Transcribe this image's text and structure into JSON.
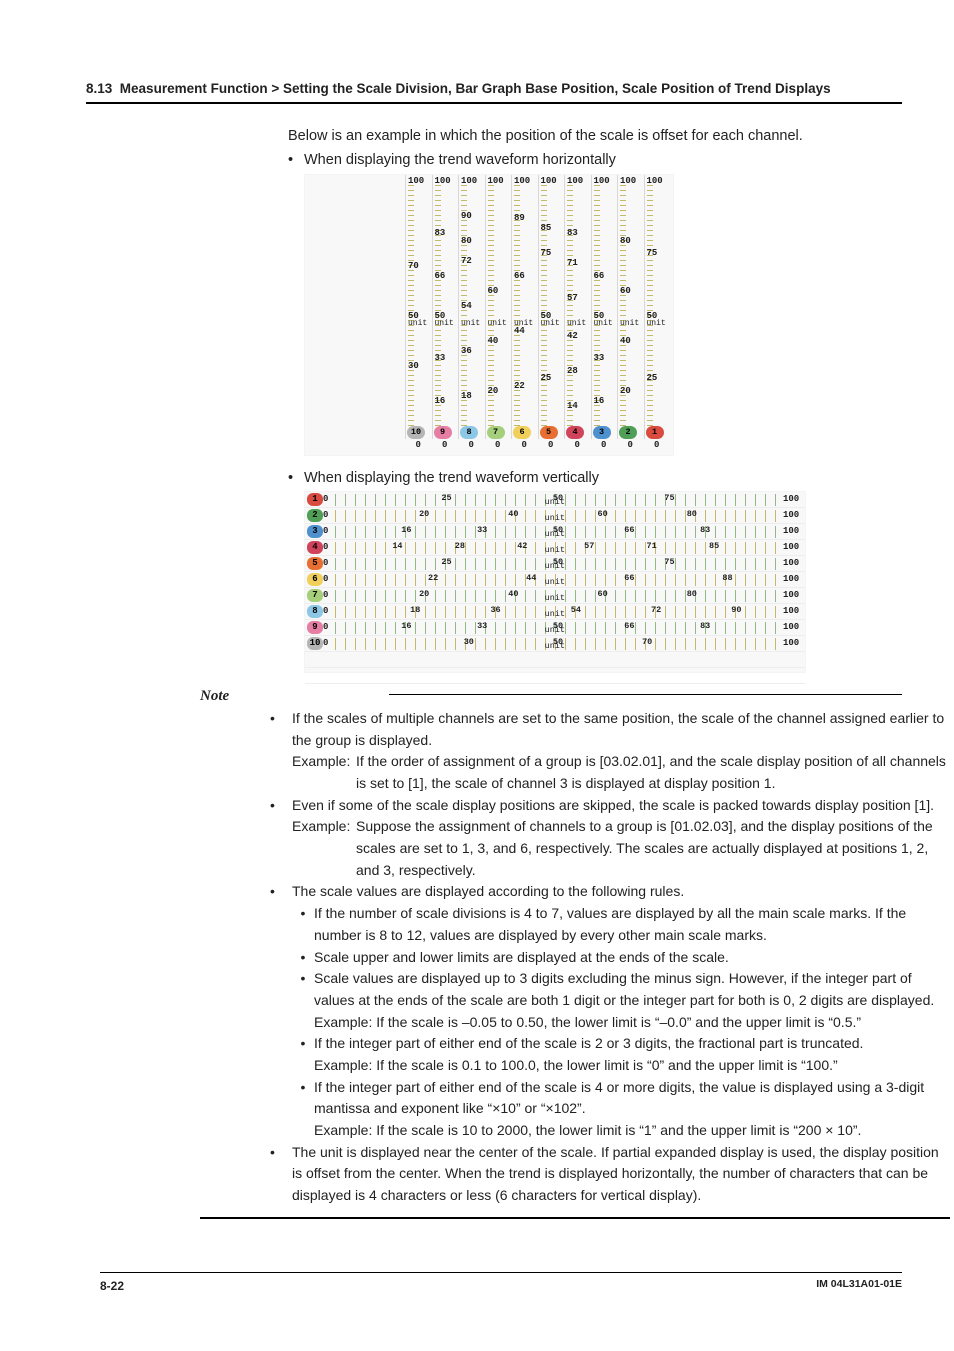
{
  "section_number": "8.13",
  "section_title": "Measurement Function > Setting the Scale Division, Bar Graph Base Position, Scale Position of Trend Displays",
  "lead": "Below is an example in which the position of the scale is offset for each channel.",
  "bullet_h": "When displaying the trend waveform horizontally",
  "bullet_v": "When displaying the trend waveform vertically",
  "fig_h": {
    "top_labels": [
      "100",
      "100",
      "100",
      "100",
      "100",
      "100",
      "100",
      "100",
      "100",
      "100"
    ],
    "zero_labels": [
      "0",
      "0",
      "0",
      "0",
      "0",
      "0",
      "0",
      "0",
      "0",
      "0"
    ],
    "unit_text": "unit",
    "cols": [
      {
        "tag": "10",
        "color": "#b5b5b5",
        "mids": [
          "70",
          "50",
          "30"
        ]
      },
      {
        "tag": "9",
        "color": "#e67ea3",
        "mids": [
          "83",
          "66",
          "50",
          "33",
          "16"
        ]
      },
      {
        "tag": "8",
        "color": "#8cc7e6",
        "mids": [
          "90",
          "80",
          "72",
          "54",
          "36",
          "18"
        ]
      },
      {
        "tag": "7",
        "color": "#a5cf7a",
        "mids": [
          "60",
          "40",
          "20"
        ]
      },
      {
        "tag": "6",
        "color": "#f0cf5b",
        "mids": [
          "89",
          "66",
          "44",
          "22"
        ]
      },
      {
        "tag": "5",
        "color": "#e86f34",
        "mids": [
          "85",
          "75",
          "50",
          "25"
        ]
      },
      {
        "tag": "4",
        "color": "#d1435b",
        "mids": [
          "83",
          "71",
          "57",
          "42",
          "28",
          "14"
        ]
      },
      {
        "tag": "3",
        "color": "#4f91cf",
        "mids": [
          "66",
          "50",
          "33",
          "16"
        ]
      },
      {
        "tag": "2",
        "color": "#4fa056",
        "mids": [
          "80",
          "60",
          "40",
          "20"
        ]
      },
      {
        "tag": "1",
        "color": "#d94a3f",
        "mids": [
          "75",
          "50",
          "25"
        ]
      }
    ]
  },
  "fig_v": {
    "rows": [
      {
        "tag": "1",
        "color": "#d94a3f",
        "ticks": [
          "0",
          "25",
          "50",
          "75",
          "100"
        ],
        "unit": "unit"
      },
      {
        "tag": "2",
        "color": "#4fa056",
        "ticks": [
          "0",
          "20",
          "40",
          "60",
          "80",
          "100"
        ],
        "unit": "unit"
      },
      {
        "tag": "3",
        "color": "#4f91cf",
        "ticks": [
          "0",
          "16",
          "33",
          "50",
          "66",
          "83",
          "100"
        ],
        "unit": "unit"
      },
      {
        "tag": "4",
        "color": "#d1435b",
        "ticks": [
          "0",
          "14",
          "28",
          "42",
          "57",
          "71",
          "85",
          "100"
        ],
        "unit": "unit"
      },
      {
        "tag": "5",
        "color": "#e86f34",
        "ticks": [
          "0",
          "25",
          "50",
          "75",
          "100"
        ],
        "unit": "unit"
      },
      {
        "tag": "6",
        "color": "#f0cf5b",
        "ticks": [
          "0",
          "22",
          "44",
          "66",
          "88",
          "100"
        ],
        "unit": "unit"
      },
      {
        "tag": "7",
        "color": "#a5cf7a",
        "ticks": [
          "0",
          "20",
          "40",
          "60",
          "80",
          "100"
        ],
        "unit": "unit"
      },
      {
        "tag": "8",
        "color": "#8cc7e6",
        "ticks": [
          "0",
          "18",
          "36",
          "54",
          "72",
          "90",
          "100"
        ],
        "unit": "unit"
      },
      {
        "tag": "9",
        "color": "#e67ea3",
        "ticks": [
          "0",
          "16",
          "33",
          "50",
          "66",
          "83",
          "100"
        ],
        "unit": "unit"
      },
      {
        "tag": "10",
        "color": "#b5b5b5",
        "ticks": [
          "0",
          "30",
          "50",
          "70",
          "100"
        ],
        "unit": "unit"
      }
    ]
  },
  "note_header": "Note",
  "notes": {
    "n1": "If the scales of multiple channels are set to the same position, the scale of the channel assigned earlier to the group is displayed.",
    "n1_ex_lbl": "Example:",
    "n1_ex": "If the order of assignment of a group is [03.02.01], and the scale display position of all channels is set to [1], the scale of channel 3 is displayed at display position 1.",
    "n2": "Even if some of the scale display positions are skipped, the scale is packed towards display position [1].",
    "n2_ex_lbl": "Example:",
    "n2_ex": "Suppose the assignment of channels to a group is [01.02.03], and the display positions of the scales are set to 1, 3, and 6, respectively.  The scales are actually displayed at positions 1, 2, and 3, respectively.",
    "n3": "The scale values are displayed according to the following rules.",
    "n3a": "If the number of scale divisions is 4 to 7, values are displayed by all the main scale marks.  If the number is 8 to 12, values are displayed by every other main scale marks.",
    "n3b": "Scale upper and lower limits are displayed at the ends of the scale.",
    "n3c": "Scale values are displayed up to 3 digits excluding the minus sign.  However, if the integer part of values at the ends of the scale are both 1 digit or the integer part for both is 0, 2 digits are displayed.",
    "n3c_ex": "Example: If the scale is –0.05 to 0.50, the lower limit is “–0.0” and the upper limit is “0.5.”",
    "n3d": "If the integer part of either end of the scale is 2 or 3 digits, the fractional part is truncated.",
    "n3d_ex": "Example: If the scale is 0.1 to 100.0, the lower limit is “0” and the upper limit is “100.”",
    "n3e": "If the integer part of either end of the scale is 4 or more digits, the value is displayed using a 3-digit mantissa and exponent like “×10” or “×102”.",
    "n3e_ex": "Example: If the scale is 10 to 2000, the lower limit is “1” and the upper limit is “200 × 10”.",
    "n4": "The unit is displayed near the center of the scale.  If partial expanded display is used, the display position is offset from the center.  When the trend is displayed horizontally, the number of characters that can be displayed is 4 characters or less (6 characters for vertical display)."
  },
  "page_number": "8-22",
  "doc_code": "IM 04L31A01-01E"
}
